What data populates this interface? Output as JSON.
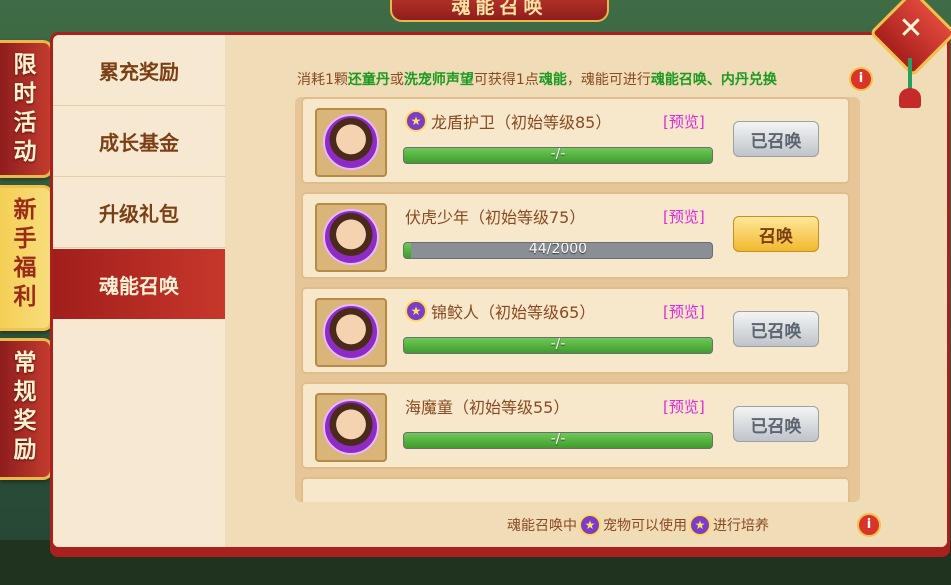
{
  "side_tabs": [
    {
      "label": "限时活动",
      "chars": [
        "限",
        "时",
        "活",
        "动"
      ],
      "active": false
    },
    {
      "label": "新手福利",
      "chars": [
        "新",
        "手",
        "福",
        "利"
      ],
      "active": true
    },
    {
      "label": "常规奖励",
      "chars": [
        "常",
        "规",
        "奖",
        "励"
      ],
      "active": false
    }
  ],
  "banner": {
    "title": "魂能召唤"
  },
  "menu": {
    "items": [
      {
        "label": "累充奖励",
        "active": false
      },
      {
        "label": "成长基金",
        "active": false
      },
      {
        "label": "升级礼包",
        "active": false
      },
      {
        "label": "魂能召唤",
        "active": true
      }
    ]
  },
  "info": {
    "p1": "消耗1颗",
    "item1": "还童丹",
    "p2": "或",
    "item2": "洗宠师声望",
    "p3": "可获得1点",
    "item3": "魂能",
    "p4": "，魂能可进行",
    "item4": "魂能召唤、内丹兑换",
    "icon": "i"
  },
  "pets": [
    {
      "name": "龙盾护卫（初始等级85）",
      "star": true,
      "preview": "[预览]",
      "progress_text": "-/-",
      "progress_pct": 100,
      "button": "已召唤",
      "button_state": "disabled"
    },
    {
      "name": "伏虎少年（初始等级75）",
      "star": false,
      "preview": "[预览]",
      "progress_text": "44/2000",
      "progress_pct": 2.2,
      "button": "召唤",
      "button_state": "enabled"
    },
    {
      "name": "锦鲛人（初始等级65）",
      "star": true,
      "preview": "[预览]",
      "progress_text": "-/-",
      "progress_pct": 100,
      "button": "已召唤",
      "button_state": "disabled"
    },
    {
      "name": "海魔童（初始等级55）",
      "star": false,
      "preview": "[预览]",
      "progress_text": "-/-",
      "progress_pct": 100,
      "button": "已召唤",
      "button_state": "disabled"
    }
  ],
  "footer": {
    "p1": "魂能召唤中",
    "p2": "宠物可以使用",
    "p3": "进行培养"
  },
  "close": {
    "label": "✕"
  },
  "icons": {
    "star": "★"
  }
}
